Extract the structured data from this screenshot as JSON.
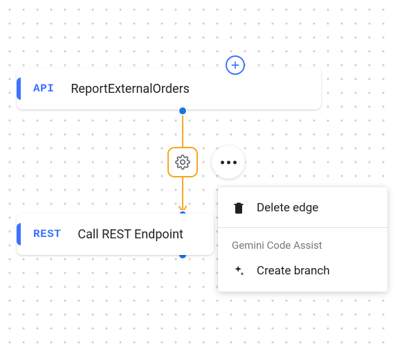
{
  "nodes": {
    "api": {
      "tag": "API",
      "title": "ReportExternalOrders"
    },
    "rest": {
      "tag": "REST",
      "title": "Call REST Endpoint"
    }
  },
  "edge": {
    "settings_icon": "gear-icon"
  },
  "buttons": {
    "add": "+",
    "kebab": "•••"
  },
  "menu": {
    "delete_label": "Delete edge",
    "section_label": "Gemini Code Assist",
    "create_branch_label": "Create branch"
  }
}
